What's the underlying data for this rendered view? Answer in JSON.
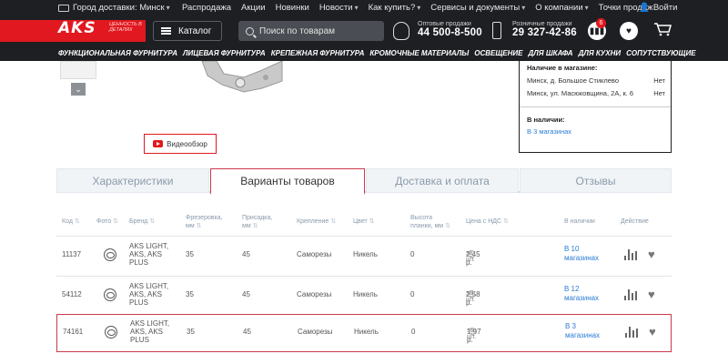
{
  "topbar": {
    "delivery_city": "Город доставки: Минск",
    "nav": [
      "Распродажа",
      "Акции",
      "Новинки",
      "Новости",
      "Как купить?",
      "Сервисы и документы",
      "О компании",
      "Точки продаж"
    ],
    "login": "Войти"
  },
  "header": {
    "logo": "AKS",
    "tagline": "ЦЕННОСТЬ В ДЕТАЛЯХ",
    "catalog": "Каталог",
    "search_placeholder": "Поиск по товарам",
    "wholesale_label": "Оптовые продажи",
    "wholesale_phone": "44 500-8-500",
    "retail_label": "Розничные продажи",
    "retail_phone": "29 327-42-86",
    "compare_badge": "6"
  },
  "categories": [
    "ФУНКЦИОНАЛЬНАЯ ФУРНИТУРА",
    "ЛИЦЕВАЯ ФУРНИТУРА",
    "КРЕПЕЖНАЯ ФУРНИТУРА",
    "КРОМОЧНЫЕ МАТЕРИАЛЫ",
    "ОСВЕЩЕНИЕ",
    "ДЛЯ ШКАФА",
    "ДЛЯ КУХНИ",
    "СОПУТСТВУЮЩИЕ"
  ],
  "product": {
    "video_review": "Видеообзор"
  },
  "availability": {
    "title": "Наличие в магазине:",
    "stores": [
      {
        "address": "Минск, д. Большое Стиклево",
        "status": "Нет"
      },
      {
        "address": "Минск, ул. Масюковщина, 2А, к. 6",
        "status": "Нет"
      }
    ],
    "in_stock_title": "В наличии:",
    "in_stock_link": "В 3 магазинах"
  },
  "tabs": [
    "Характеристики",
    "Варианты товаров",
    "Доставка и оплата",
    "Отзывы"
  ],
  "table": {
    "headers": {
      "code": "Код",
      "photo": "Фото",
      "brand": "Бренд",
      "milling": "Фрезеровка, мм",
      "overlay": "Присадка, мм",
      "fastening": "Крепление",
      "color": "Цвет",
      "plate_height": "Высота планки, мм",
      "price": "Цена с НДС",
      "in_stock": "В наличии",
      "action": "Действие"
    },
    "unit_suffix": "за шт.",
    "rows": [
      {
        "code": "11137",
        "brand": "AKS LIGHT, AKS, AKS PLUS",
        "milling": "35",
        "overlay": "45",
        "fastening": "Саморезы",
        "color": "Никель",
        "plate_height": "0",
        "price": "2.45 р.",
        "stock": "В 10 магазинах"
      },
      {
        "code": "54112",
        "brand": "AKS LIGHT, AKS, AKS PLUS",
        "milling": "35",
        "overlay": "45",
        "fastening": "Саморезы",
        "color": "Никель",
        "plate_height": "0",
        "price": "2.58 р.",
        "stock": "В 12 магазинах"
      },
      {
        "code": "74161",
        "brand": "AKS LIGHT, AKS, AKS PLUS",
        "milling": "35",
        "overlay": "45",
        "fastening": "Саморезы",
        "color": "Никель",
        "plate_height": "0",
        "price": "1.97 р.",
        "stock": "В 3 магазинах"
      }
    ]
  },
  "icons": {
    "truck": "truck-icon",
    "user": "user-icon",
    "menu": "menu-icon",
    "search": "search-icon",
    "headset": "headset-icon",
    "mobile": "mobile-icon",
    "compare": "compare-icon",
    "favorite": "heart-icon",
    "cart": "cart-icon",
    "eye": "eye-icon",
    "youtube": "youtube-icon"
  },
  "colors": {
    "brand_red": "#e1181f",
    "dark": "#1d1f23",
    "link": "#2b7cd6",
    "highlight": "#c83a4a"
  }
}
